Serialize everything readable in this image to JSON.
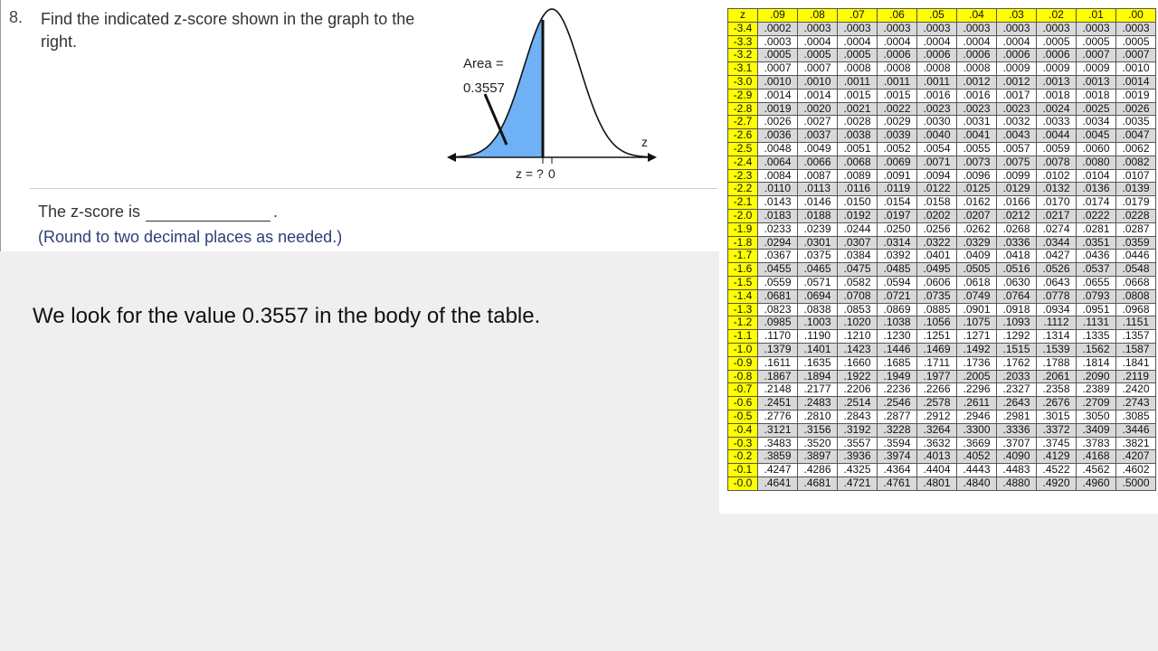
{
  "problem": {
    "number": "8.",
    "question": "Find the indicated z-score shown in the graph to the right.",
    "answer_prefix": "The z-score is",
    "answer_suffix": ".",
    "round_note": "(Round to two decimal places as needed.)"
  },
  "graph": {
    "area_label": "Area =",
    "area_value": "0.3557",
    "axis_label": "z",
    "z_marker": "z = ?",
    "zero_label": "0",
    "shade_color": "#6fb1f5"
  },
  "narration": "We look for the value 0.3557 in the body of the table.",
  "ztable": {
    "corner": "z",
    "headers": [
      ".09",
      ".08",
      ".07",
      ".06",
      ".05",
      ".04",
      ".03",
      ".02",
      ".01",
      ".00"
    ],
    "rows": [
      {
        "z": "-3.4",
        "v": [
          ".0002",
          ".0003",
          ".0003",
          ".0003",
          ".0003",
          ".0003",
          ".0003",
          ".0003",
          ".0003",
          ".0003"
        ]
      },
      {
        "z": "-3.3",
        "v": [
          ".0003",
          ".0004",
          ".0004",
          ".0004",
          ".0004",
          ".0004",
          ".0004",
          ".0005",
          ".0005",
          ".0005"
        ]
      },
      {
        "z": "-3.2",
        "v": [
          ".0005",
          ".0005",
          ".0005",
          ".0006",
          ".0006",
          ".0006",
          ".0006",
          ".0006",
          ".0007",
          ".0007"
        ]
      },
      {
        "z": "-3.1",
        "v": [
          ".0007",
          ".0007",
          ".0008",
          ".0008",
          ".0008",
          ".0008",
          ".0009",
          ".0009",
          ".0009",
          ".0010"
        ]
      },
      {
        "z": "-3.0",
        "v": [
          ".0010",
          ".0010",
          ".0011",
          ".0011",
          ".0011",
          ".0012",
          ".0012",
          ".0013",
          ".0013",
          ".0014"
        ]
      },
      {
        "z": "-2.9",
        "v": [
          ".0014",
          ".0014",
          ".0015",
          ".0015",
          ".0016",
          ".0016",
          ".0017",
          ".0018",
          ".0018",
          ".0019"
        ]
      },
      {
        "z": "-2.8",
        "v": [
          ".0019",
          ".0020",
          ".0021",
          ".0022",
          ".0023",
          ".0023",
          ".0023",
          ".0024",
          ".0025",
          ".0026"
        ]
      },
      {
        "z": "-2.7",
        "v": [
          ".0026",
          ".0027",
          ".0028",
          ".0029",
          ".0030",
          ".0031",
          ".0032",
          ".0033",
          ".0034",
          ".0035"
        ]
      },
      {
        "z": "-2.6",
        "v": [
          ".0036",
          ".0037",
          ".0038",
          ".0039",
          ".0040",
          ".0041",
          ".0043",
          ".0044",
          ".0045",
          ".0047"
        ]
      },
      {
        "z": "-2.5",
        "v": [
          ".0048",
          ".0049",
          ".0051",
          ".0052",
          ".0054",
          ".0055",
          ".0057",
          ".0059",
          ".0060",
          ".0062"
        ]
      },
      {
        "z": "-2.4",
        "v": [
          ".0064",
          ".0066",
          ".0068",
          ".0069",
          ".0071",
          ".0073",
          ".0075",
          ".0078",
          ".0080",
          ".0082"
        ]
      },
      {
        "z": "-2.3",
        "v": [
          ".0084",
          ".0087",
          ".0089",
          ".0091",
          ".0094",
          ".0096",
          ".0099",
          ".0102",
          ".0104",
          ".0107"
        ]
      },
      {
        "z": "-2.2",
        "v": [
          ".0110",
          ".0113",
          ".0116",
          ".0119",
          ".0122",
          ".0125",
          ".0129",
          ".0132",
          ".0136",
          ".0139"
        ]
      },
      {
        "z": "-2.1",
        "v": [
          ".0143",
          ".0146",
          ".0150",
          ".0154",
          ".0158",
          ".0162",
          ".0166",
          ".0170",
          ".0174",
          ".0179"
        ]
      },
      {
        "z": "-2.0",
        "v": [
          ".0183",
          ".0188",
          ".0192",
          ".0197",
          ".0202",
          ".0207",
          ".0212",
          ".0217",
          ".0222",
          ".0228"
        ]
      },
      {
        "z": "-1.9",
        "v": [
          ".0233",
          ".0239",
          ".0244",
          ".0250",
          ".0256",
          ".0262",
          ".0268",
          ".0274",
          ".0281",
          ".0287"
        ]
      },
      {
        "z": "-1.8",
        "v": [
          ".0294",
          ".0301",
          ".0307",
          ".0314",
          ".0322",
          ".0329",
          ".0336",
          ".0344",
          ".0351",
          ".0359"
        ]
      },
      {
        "z": "-1.7",
        "v": [
          ".0367",
          ".0375",
          ".0384",
          ".0392",
          ".0401",
          ".0409",
          ".0418",
          ".0427",
          ".0436",
          ".0446"
        ]
      },
      {
        "z": "-1.6",
        "v": [
          ".0455",
          ".0465",
          ".0475",
          ".0485",
          ".0495",
          ".0505",
          ".0516",
          ".0526",
          ".0537",
          ".0548"
        ]
      },
      {
        "z": "-1.5",
        "v": [
          ".0559",
          ".0571",
          ".0582",
          ".0594",
          ".0606",
          ".0618",
          ".0630",
          ".0643",
          ".0655",
          ".0668"
        ]
      },
      {
        "z": "-1.4",
        "v": [
          ".0681",
          ".0694",
          ".0708",
          ".0721",
          ".0735",
          ".0749",
          ".0764",
          ".0778",
          ".0793",
          ".0808"
        ]
      },
      {
        "z": "-1.3",
        "v": [
          ".0823",
          ".0838",
          ".0853",
          ".0869",
          ".0885",
          ".0901",
          ".0918",
          ".0934",
          ".0951",
          ".0968"
        ]
      },
      {
        "z": "-1.2",
        "v": [
          ".0985",
          ".1003",
          ".1020",
          ".1038",
          ".1056",
          ".1075",
          ".1093",
          ".1112",
          ".1131",
          ".1151"
        ]
      },
      {
        "z": "-1.1",
        "v": [
          ".1170",
          ".1190",
          ".1210",
          ".1230",
          ".1251",
          ".1271",
          ".1292",
          ".1314",
          ".1335",
          ".1357"
        ]
      },
      {
        "z": "-1.0",
        "v": [
          ".1379",
          ".1401",
          ".1423",
          ".1446",
          ".1469",
          ".1492",
          ".1515",
          ".1539",
          ".1562",
          ".1587"
        ]
      },
      {
        "z": "-0.9",
        "v": [
          ".1611",
          ".1635",
          ".1660",
          ".1685",
          ".1711",
          ".1736",
          ".1762",
          ".1788",
          ".1814",
          ".1841"
        ]
      },
      {
        "z": "-0.8",
        "v": [
          ".1867",
          ".1894",
          ".1922",
          ".1949",
          ".1977",
          ".2005",
          ".2033",
          ".2061",
          ".2090",
          ".2119"
        ]
      },
      {
        "z": "-0.7",
        "v": [
          ".2148",
          ".2177",
          ".2206",
          ".2236",
          ".2266",
          ".2296",
          ".2327",
          ".2358",
          ".2389",
          ".2420"
        ]
      },
      {
        "z": "-0.6",
        "v": [
          ".2451",
          ".2483",
          ".2514",
          ".2546",
          ".2578",
          ".2611",
          ".2643",
          ".2676",
          ".2709",
          ".2743"
        ]
      },
      {
        "z": "-0.5",
        "v": [
          ".2776",
          ".2810",
          ".2843",
          ".2877",
          ".2912",
          ".2946",
          ".2981",
          ".3015",
          ".3050",
          ".3085"
        ]
      },
      {
        "z": "-0.4",
        "v": [
          ".3121",
          ".3156",
          ".3192",
          ".3228",
          ".3264",
          ".3300",
          ".3336",
          ".3372",
          ".3409",
          ".3446"
        ]
      },
      {
        "z": "-0.3",
        "v": [
          ".3483",
          ".3520",
          ".3557",
          ".3594",
          ".3632",
          ".3669",
          ".3707",
          ".3745",
          ".3783",
          ".3821"
        ]
      },
      {
        "z": "-0.2",
        "v": [
          ".3859",
          ".3897",
          ".3936",
          ".3974",
          ".4013",
          ".4052",
          ".4090",
          ".4129",
          ".4168",
          ".4207"
        ]
      },
      {
        "z": "-0.1",
        "v": [
          ".4247",
          ".4286",
          ".4325",
          ".4364",
          ".4404",
          ".4443",
          ".4483",
          ".4522",
          ".4562",
          ".4602"
        ]
      },
      {
        "z": "-0.0",
        "v": [
          ".4641",
          ".4681",
          ".4721",
          ".4761",
          ".4801",
          ".4840",
          ".4880",
          ".4920",
          ".4960",
          ".5000"
        ]
      }
    ]
  }
}
